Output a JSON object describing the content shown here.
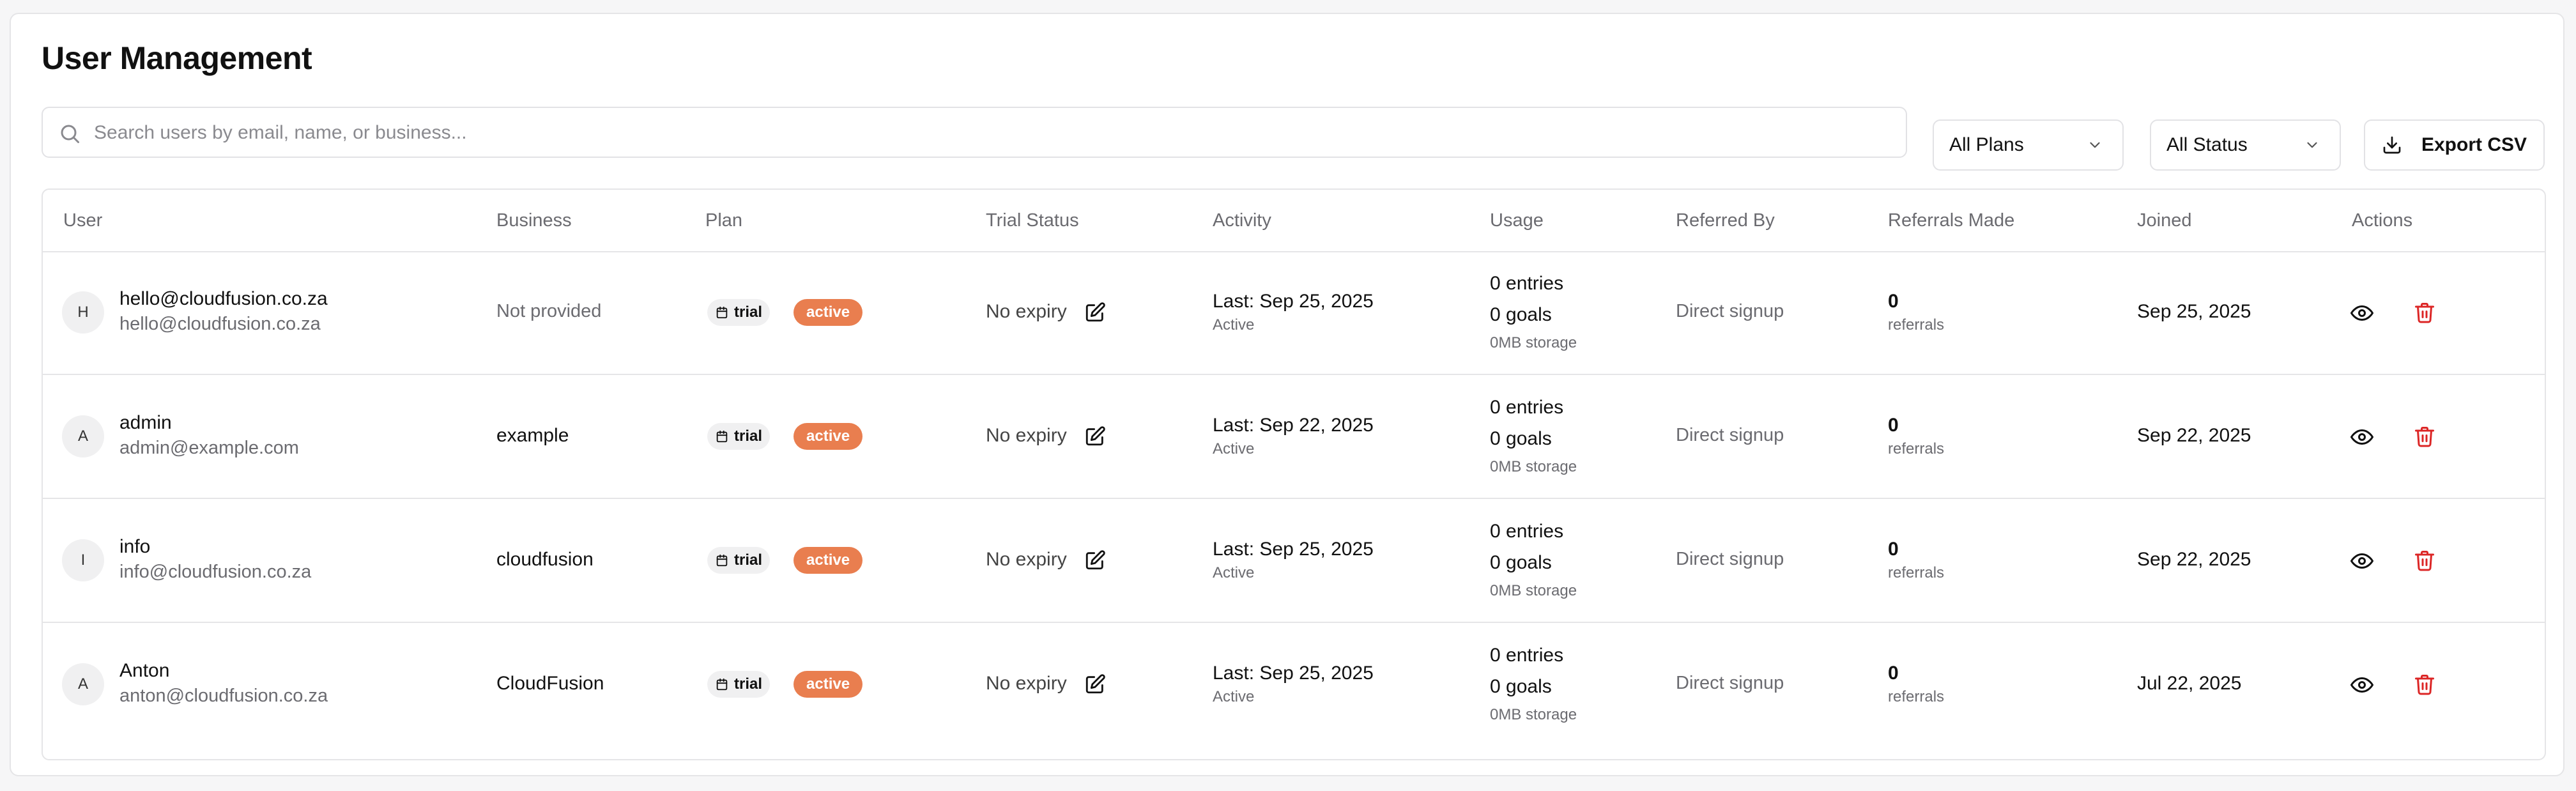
{
  "page": {
    "title": "User Management"
  },
  "search": {
    "placeholder": "Search users by email, name, or business..."
  },
  "filters": {
    "plans": {
      "selected": "All Plans"
    },
    "status": {
      "selected": "All Status"
    }
  },
  "export": {
    "label": "Export CSV"
  },
  "table": {
    "headers": {
      "user": "User",
      "business": "Business",
      "plan": "Plan",
      "trial_status": "Trial Status",
      "activity": "Activity",
      "usage": "Usage",
      "referred_by": "Referred By",
      "referrals_made": "Referrals Made",
      "joined": "Joined",
      "actions": "Actions"
    },
    "rows": [
      {
        "initial": "H",
        "name": "hello@cloudfusion.co.za",
        "email": "hello@cloudfusion.co.za",
        "business": "Not provided",
        "business_muted": true,
        "plan": "trial",
        "status": "active",
        "trial_status": "No expiry",
        "activity_last": "Last: Sep 25, 2025",
        "activity_state": "Active",
        "entries": "0 entries",
        "goals": "0 goals",
        "storage": "0MB storage",
        "referred_by": "Direct signup",
        "referrals_count": "0",
        "referrals_label": "referrals",
        "joined": "Sep 25, 2025"
      },
      {
        "initial": "A",
        "name": "admin",
        "email": "admin@example.com",
        "business": "example",
        "business_muted": false,
        "plan": "trial",
        "status": "active",
        "trial_status": "No expiry",
        "activity_last": "Last: Sep 22, 2025",
        "activity_state": "Active",
        "entries": "0 entries",
        "goals": "0 goals",
        "storage": "0MB storage",
        "referred_by": "Direct signup",
        "referrals_count": "0",
        "referrals_label": "referrals",
        "joined": "Sep 22, 2025"
      },
      {
        "initial": "I",
        "name": "info",
        "email": "info@cloudfusion.co.za",
        "business": "cloudfusion",
        "business_muted": false,
        "plan": "trial",
        "status": "active",
        "trial_status": "No expiry",
        "activity_last": "Last: Sep 25, 2025",
        "activity_state": "Active",
        "entries": "0 entries",
        "goals": "0 goals",
        "storage": "0MB storage",
        "referred_by": "Direct signup",
        "referrals_count": "0",
        "referrals_label": "referrals",
        "joined": "Sep 22, 2025"
      },
      {
        "initial": "A",
        "name": "Anton",
        "email": "anton@cloudfusion.co.za",
        "business": "CloudFusion",
        "business_muted": false,
        "plan": "trial",
        "status": "active",
        "trial_status": "No expiry",
        "activity_last": "Last: Sep 25, 2025",
        "activity_state": "Active",
        "entries": "0 entries",
        "goals": "0 goals",
        "storage": "0MB storage",
        "referred_by": "Direct signup",
        "referrals_count": "0",
        "referrals_label": "referrals",
        "joined": "Jul 22, 2025"
      }
    ]
  },
  "colors": {
    "accent": "#e97e4f",
    "danger": "#dc2626",
    "border": "#e5e5e7",
    "muted_text": "#6b6b70"
  },
  "icons": [
    "search-icon",
    "chevron-down-icon",
    "download-icon",
    "calendar-icon",
    "edit-icon",
    "eye-icon",
    "trash-icon"
  ]
}
